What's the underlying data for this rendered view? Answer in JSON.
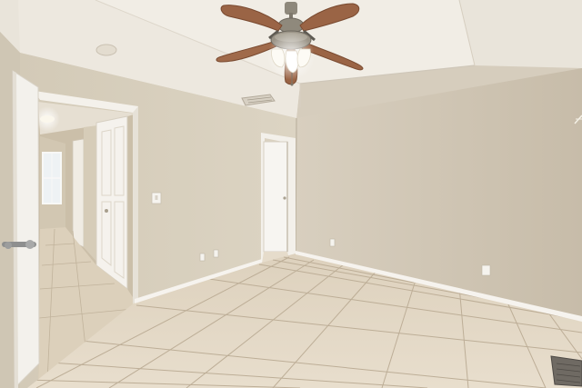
{
  "scene": {
    "kind": "photo",
    "subject": "empty-room",
    "elements": [
      "ceiling-fan",
      "tray-ceiling",
      "open-doorway",
      "hallway",
      "closet-door",
      "tile-floor",
      "hvac-vent",
      "floor-vent",
      "wall-outlets",
      "light-switch"
    ]
  },
  "colors": {
    "ceiling": "#ece7de",
    "tray": "#f2eee6",
    "wall_left": "#d9d1bf",
    "wall_back": "#d4cbba",
    "wall_right": "#cdc3b1",
    "floor": "#e3d8c6",
    "grout": "#bcae98",
    "baseboard": "#f6f3ee",
    "door": "#f7f5f2",
    "fan_blade": "#9a6445",
    "fan_metal": "#8a8478"
  }
}
